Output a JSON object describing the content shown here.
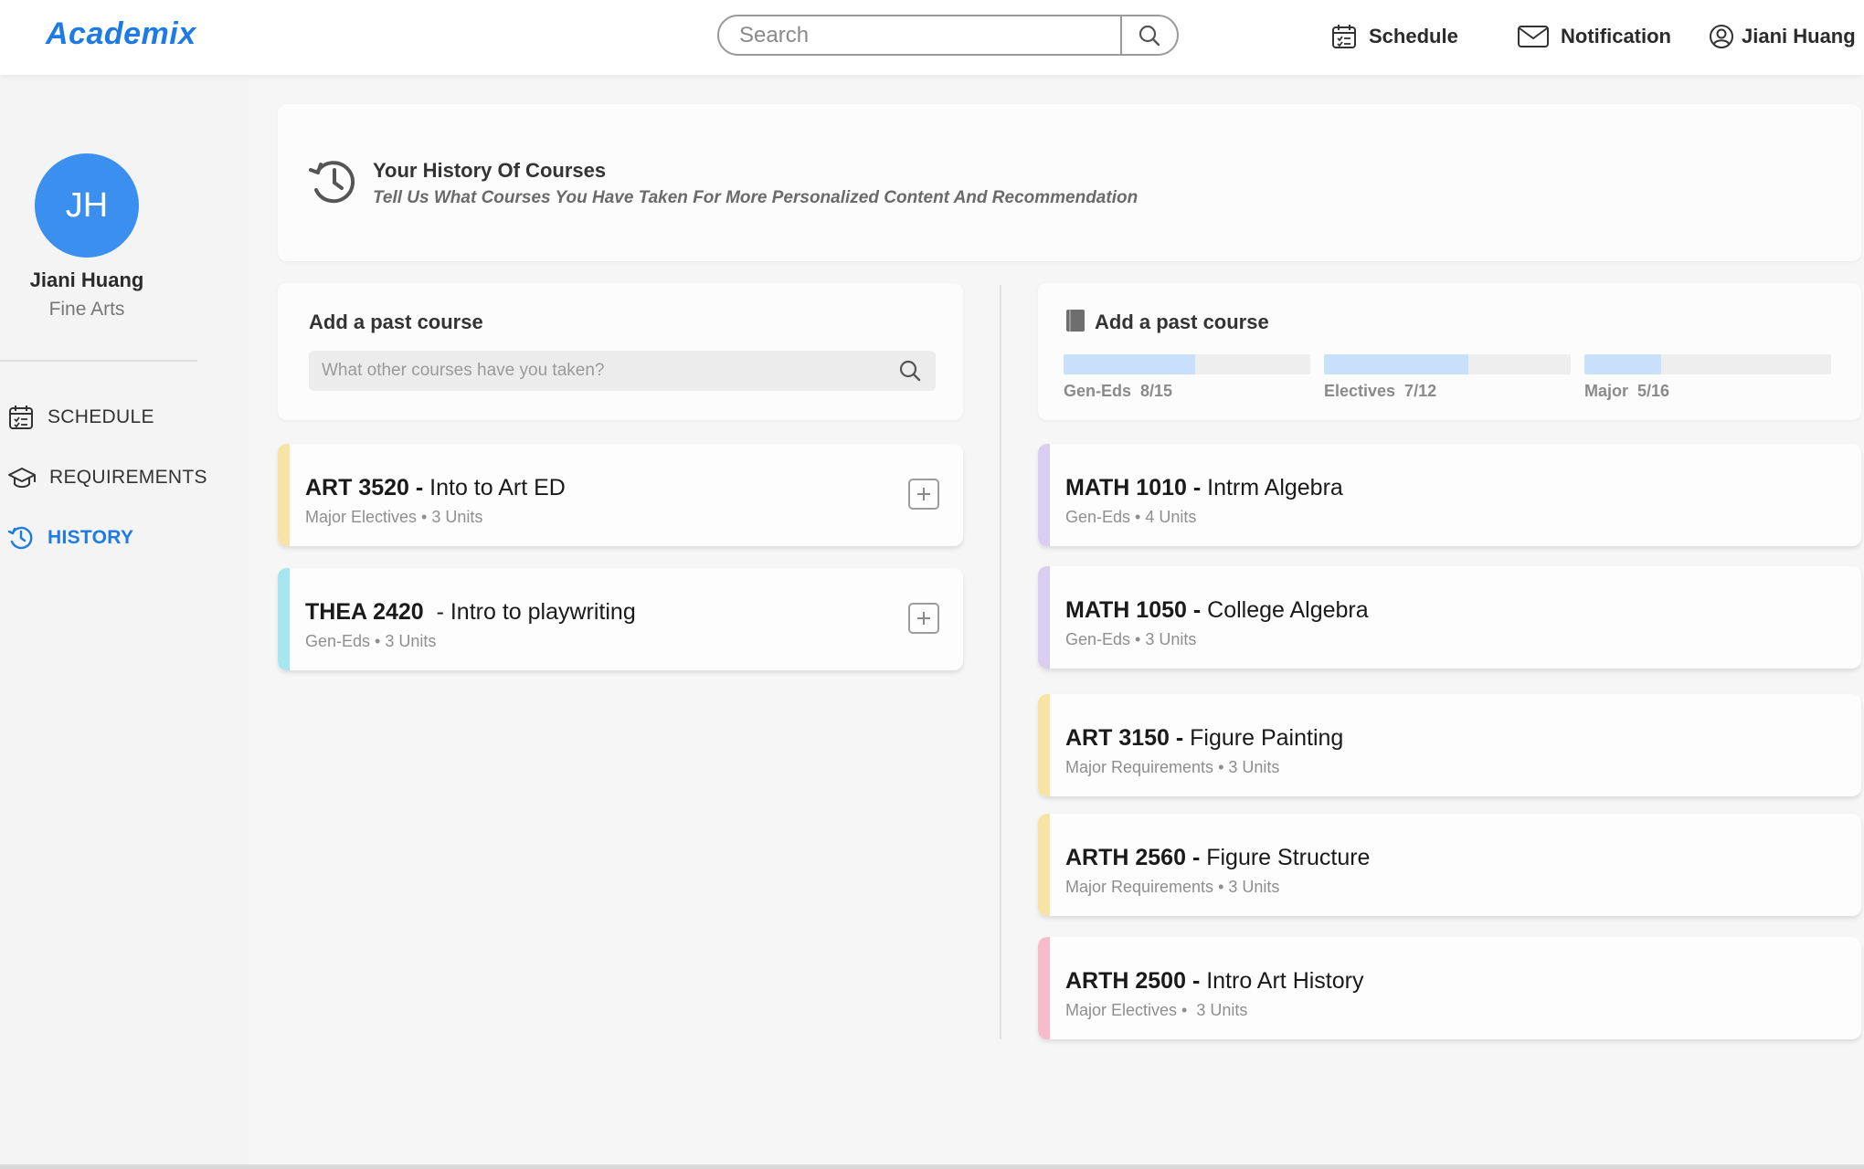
{
  "app": {
    "logo": "Academix"
  },
  "header": {
    "search_placeholder": "Search",
    "nav": {
      "schedule": "Schedule",
      "notification": "Notification",
      "user": "Jiani Huang"
    }
  },
  "sidebar": {
    "avatar_initials": "JH",
    "user_name": "Jiani Huang",
    "user_major": "Fine Arts",
    "items": [
      {
        "label": "SCHEDULE",
        "icon": "calendar-icon"
      },
      {
        "label": "REQUIREMENTS",
        "icon": "graduation-cap-icon"
      },
      {
        "label": "HISTORY",
        "icon": "history-icon",
        "active": true
      }
    ]
  },
  "history": {
    "title": "Your History Of Courses",
    "subtitle": "Tell Us What Courses You Have Taken For More Personalized Content And Recommendation"
  },
  "add_course": {
    "title": "Add a past course",
    "search_placeholder": "What other courses have you taken?"
  },
  "progress_panel": {
    "title": "Add a past course",
    "items": [
      {
        "label": "Gen-Eds  8/15",
        "completed": 8,
        "total": 15
      },
      {
        "label": "Electives  7/12",
        "completed": 7,
        "total": 12
      },
      {
        "label": "Major  5/16",
        "completed": 5,
        "total": 16
      }
    ]
  },
  "suggested_courses": [
    {
      "code": "ART 3520 -",
      "name": " Into to Art ED",
      "meta": "Major Electives • 3 Units",
      "accent": "#f7e3a6"
    },
    {
      "code": "THEA 2420 ",
      "name": " - Intro to playwriting",
      "meta": "Gen-Eds • 3 Units",
      "accent": "#a6e6ee"
    }
  ],
  "taken_courses": [
    {
      "code": "MATH 1010 -",
      "name": " Intrm Algebra",
      "meta": "Gen-Eds • 4 Units",
      "accent": "#d9cdf2"
    },
    {
      "code": "MATH 1050 -",
      "name": " College Algebra",
      "meta": "Gen-Eds • 3 Units",
      "accent": "#d9cdf2"
    },
    {
      "code": "ART 3150 -",
      "name": " Figure Painting",
      "meta": "Major Requirements • 3 Units",
      "accent": "#f7e3a6"
    },
    {
      "code": "ARTH 2560 -",
      "name": " Figure Structure",
      "meta": "Major Requirements • 3 Units",
      "accent": "#f7e3a6"
    },
    {
      "code": "ARTH 2500 -",
      "name": " Intro Art History",
      "meta": "Major Electives •  3 Units",
      "accent": "#f6bccb"
    }
  ],
  "colors": {
    "brand": "#1e7be6",
    "avatar": "#3b8fef",
    "progress_fill": "#c9e0fb"
  }
}
